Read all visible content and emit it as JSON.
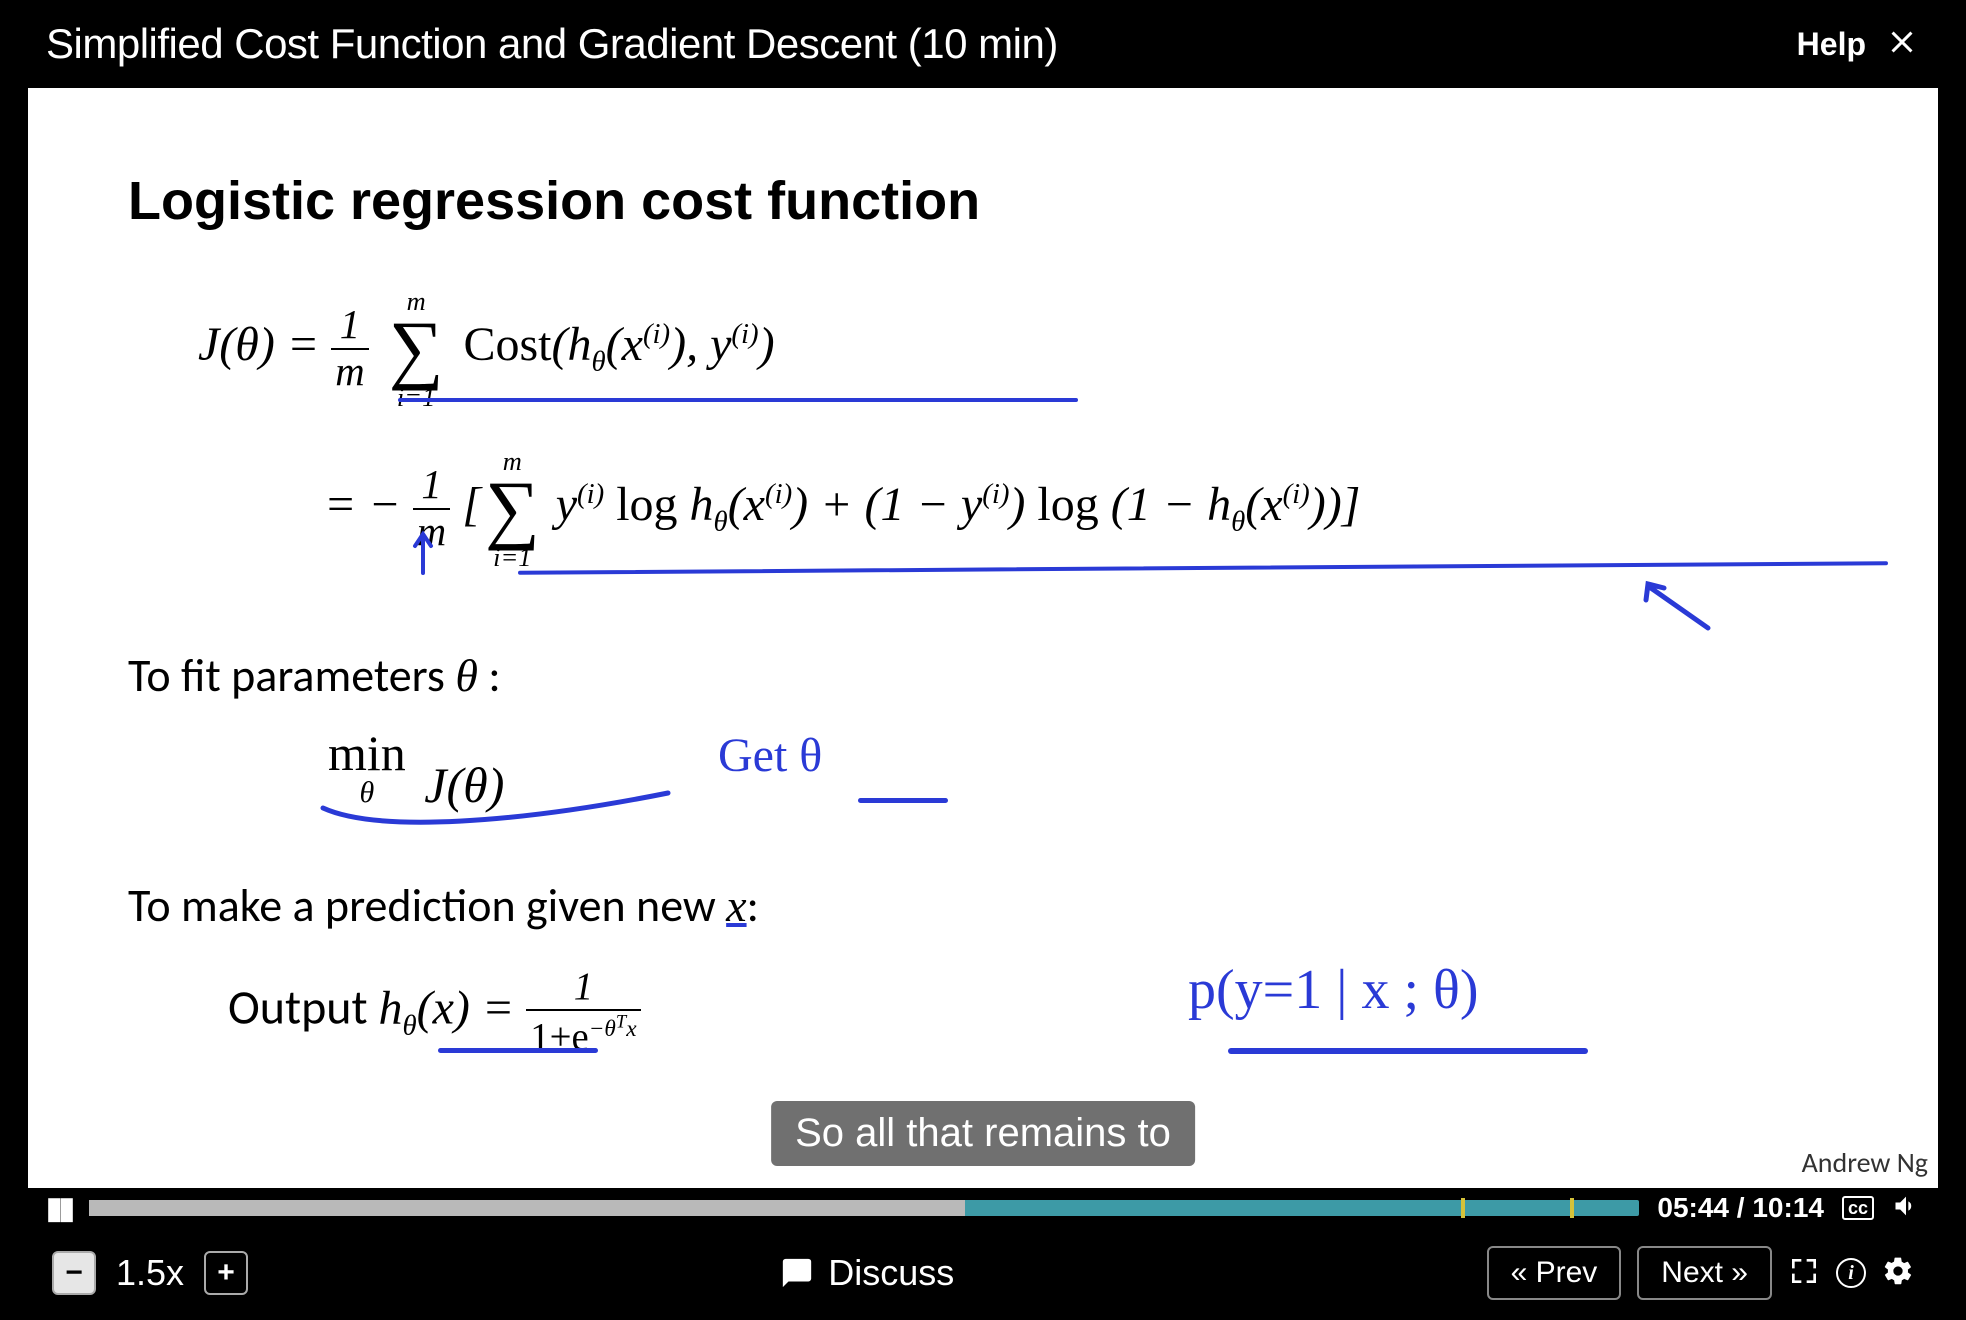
{
  "header": {
    "title": "Simplified Cost Function and Gradient Descent (10 min)",
    "help_label": "Help"
  },
  "slide": {
    "heading": "Logistic regression cost function",
    "formula1_lhs": "J(θ) = ",
    "formula1_frac_num": "1",
    "formula1_frac_den": "m",
    "formula1_sum_top": "m",
    "formula1_sum_bot": "i=1",
    "formula1_rhs": "Cost(hθ(x(i)), y(i))",
    "formula2_prefix": "= −",
    "formula2_frac_num": "1",
    "formula2_frac_den": "m",
    "formula2_sum_top": "m",
    "formula2_sum_bot": "i=1",
    "formula2_body": "[∑ y(i) log hθ(x(i)) + (1 − y(i)) log (1 − hθ(x(i)))]",
    "fit_line": "To fit parameters θ :",
    "min_expr": "min J(θ)",
    "min_sub": "θ",
    "anno_get": "Get θ",
    "predict_line": "To make a prediction given new x:",
    "output_lhs": "Output  hθ(x) = ",
    "output_frac_num": "1",
    "output_frac_den": "1+e−θᵀx",
    "anno_prob": "p(y=1 | x ; θ)",
    "author": "Andrew Ng"
  },
  "caption": "So all that remains to",
  "progress": {
    "played_pct": 0.565,
    "buffered_pct": 1.0,
    "marks_pct": [
      0.885,
      0.955
    ],
    "time_current": "05:44",
    "time_total": "10:14",
    "cc_label": "cc"
  },
  "bottom": {
    "speed": "1.5x",
    "discuss": "Discuss",
    "prev": "« Prev",
    "next": "Next »"
  }
}
